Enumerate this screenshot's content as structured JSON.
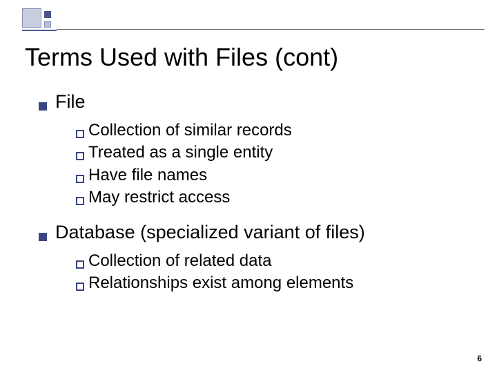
{
  "slide": {
    "title": "Terms Used with Files (cont)",
    "page_number": "6",
    "items": [
      {
        "label": "File",
        "sub": [
          "Collection of similar records",
          "Treated as a single entity",
          "Have file names",
          "May restrict access"
        ]
      },
      {
        "label": "Database (specialized variant of files)",
        "sub": [
          "Collection of related data",
          "Relationships exist among elements"
        ]
      }
    ]
  }
}
